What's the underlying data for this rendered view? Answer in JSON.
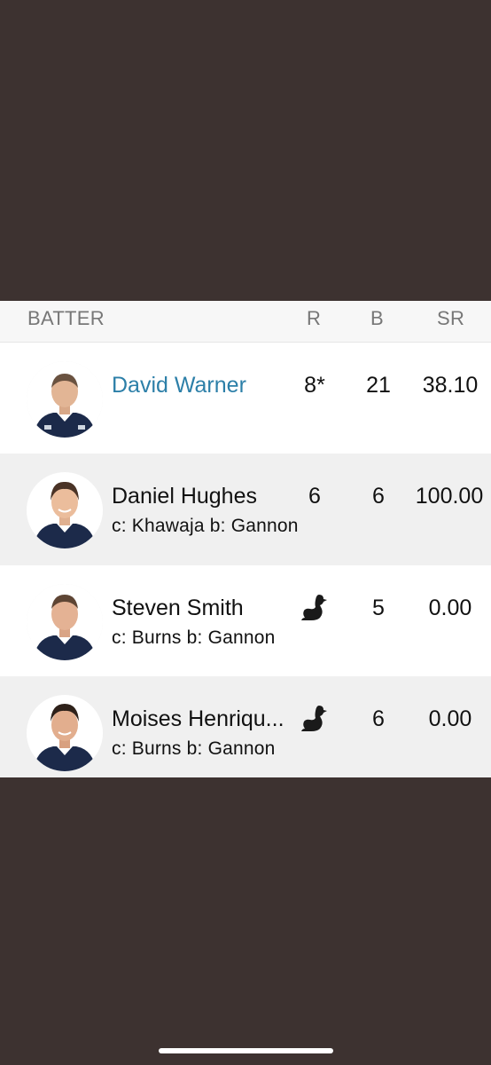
{
  "table": {
    "headers": {
      "batter": "BATTER",
      "runs": "R",
      "balls": "B",
      "strike_rate": "SR"
    },
    "rows": [
      {
        "name": "David Warner",
        "dismissal": "",
        "runs": "8*",
        "balls": "21",
        "strike_rate": "38.10",
        "duck": false,
        "highlight": true
      },
      {
        "name": "Daniel Hughes",
        "dismissal": "c: Khawaja b: Gannon",
        "runs": "6",
        "balls": "6",
        "strike_rate": "100.00",
        "duck": false
      },
      {
        "name": "Steven Smith",
        "dismissal": "c: Burns b: Gannon",
        "runs": "",
        "balls": "5",
        "strike_rate": "0.00",
        "duck": true
      },
      {
        "name": "Moises Henriqu...",
        "dismissal": "c: Burns b: Gannon",
        "runs": "",
        "balls": "6",
        "strike_rate": "0.00",
        "duck": true
      }
    ]
  },
  "icons": {
    "duck": "duck-icon",
    "avatar": "player-avatar"
  },
  "colors": {
    "background": "#3d3230",
    "link": "#2c7fa8",
    "row_alt": "#f0f0f0",
    "header": "#f7f7f7"
  }
}
